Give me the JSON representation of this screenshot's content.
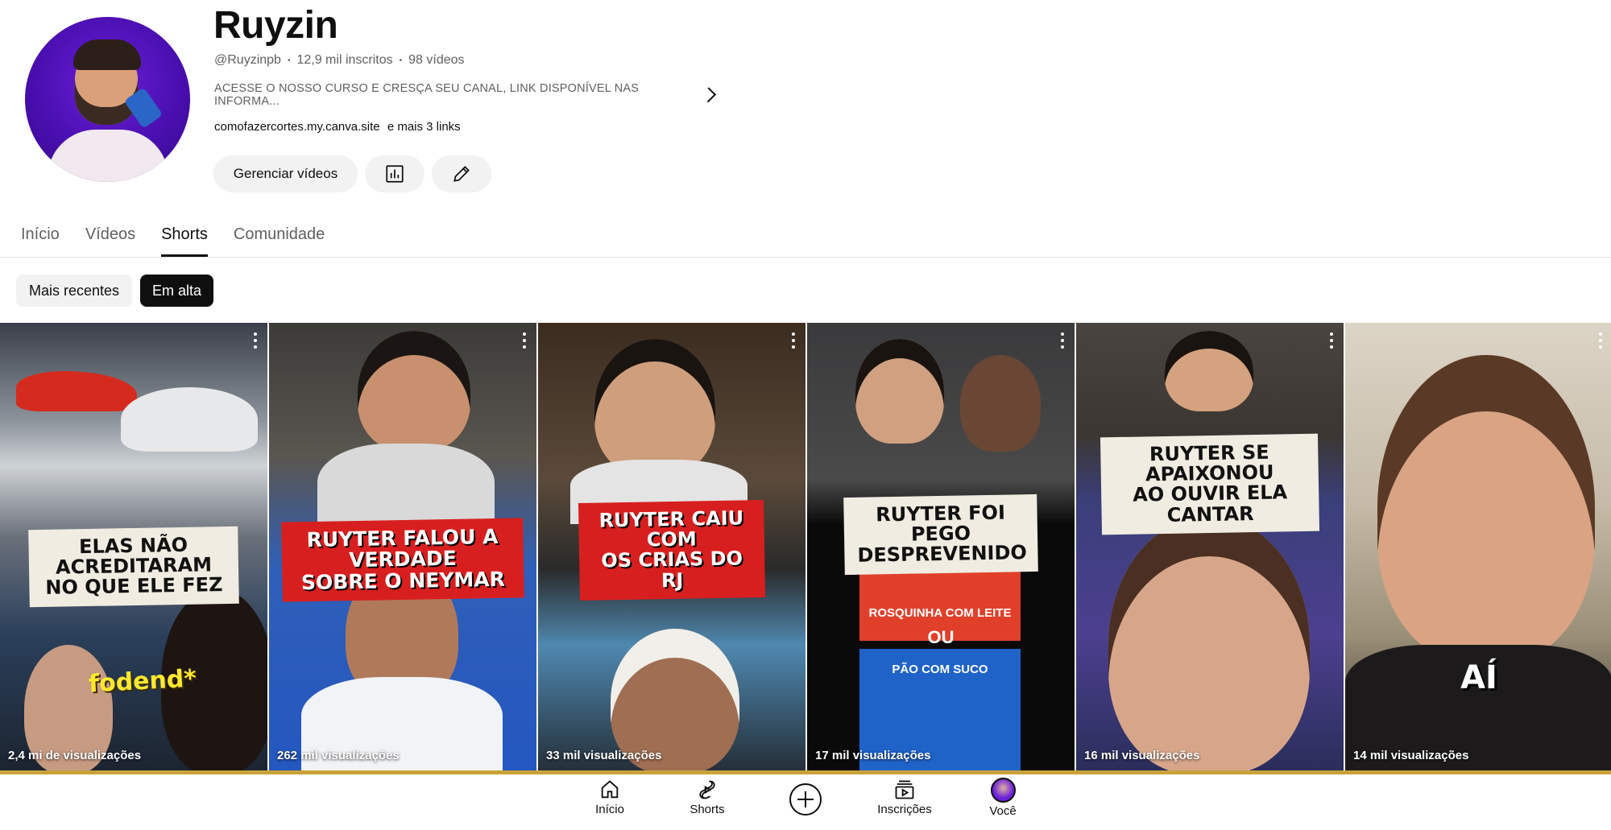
{
  "channel": {
    "name": "Ruyzin",
    "handle": "@Ruyzinpb",
    "subscribers": "12,9 mil inscritos",
    "videos": "98 vídeos",
    "description": "ACESSE O NOSSO CURSO E CRESÇA SEU CANAL, LINK DISPONÍVEL NAS INFORMA...",
    "link": "comofazercortes.my.canva.site",
    "more_links": "e mais 3 links"
  },
  "actions": {
    "manage_label": "Gerenciar vídeos",
    "stats_icon": "bar-chart-icon",
    "edit_icon": "pencil-icon"
  },
  "tabs": [
    {
      "label": "Início",
      "active": false
    },
    {
      "label": "Vídeos",
      "active": false
    },
    {
      "label": "Shorts",
      "active": true
    },
    {
      "label": "Comunidade",
      "active": false
    }
  ],
  "chips": [
    {
      "label": "Mais recentes",
      "selected": false
    },
    {
      "label": "Em alta",
      "selected": true
    }
  ],
  "shorts": [
    {
      "caption": "ELAS NÃO ACREDITARAM\nNO QUE ELE FEZ",
      "overlay": "fodend*",
      "views": "2,4 mi de visualizações"
    },
    {
      "caption": "RUYTER FALOU A VERDADE\nSOBRE O NEYMAR",
      "overlay": "",
      "views": "262 mil visualizações"
    },
    {
      "caption": "RUYTER CAIU COM\nOS CRIAS DO RJ",
      "overlay": "",
      "views": "33 mil visualizações"
    },
    {
      "caption": "RUYTER FOI PEGO\nDESPREVENIDO",
      "overlay": "ROSQUINHA COM LEITE",
      "overlay2": "OU",
      "overlay3": "PÃO COM SUCO",
      "views": "17 mil visualizações"
    },
    {
      "caption": "RUYTER SE APAIXONOU\nAO OUVIR ELA CANTAR",
      "overlay": "",
      "views": "16 mil visualizações"
    },
    {
      "caption": "",
      "overlay": "AÍ",
      "views": "14 mil visualizações"
    }
  ],
  "bottom_nav": [
    {
      "label": "Início",
      "icon": "home-icon"
    },
    {
      "label": "Shorts",
      "icon": "shorts-icon"
    },
    {
      "label": "",
      "icon": "create-icon"
    },
    {
      "label": "Inscrições",
      "icon": "subscriptions-icon"
    },
    {
      "label": "Você",
      "icon": "avatar-icon"
    }
  ],
  "colors": {
    "accent_dark": "#0f0f0f",
    "chip_bg": "#f2f2f2",
    "secondary_text": "#606060",
    "avatar_purple": "#4a0fb0"
  }
}
